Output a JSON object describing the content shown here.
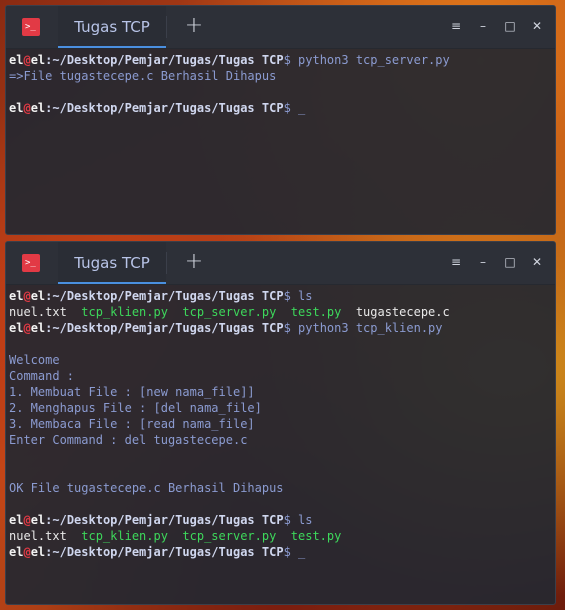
{
  "windows": [
    {
      "tab_title": "Tugas TCP",
      "lines": [
        {
          "type": "prompt",
          "user": "el",
          "at": "@",
          "host": "el",
          "path": ":~/Desktop/Pemjar/Tugas/Tugas TCP",
          "dollar": "$ ",
          "cmd": "python3 tcp_server.py"
        },
        {
          "type": "out",
          "text": "=>File tugastecepe.c Berhasil Dihapus"
        },
        {
          "type": "blank"
        },
        {
          "type": "prompt",
          "user": "el",
          "at": "@",
          "host": "el",
          "path": ":~/Desktop/Pemjar/Tugas/Tugas TCP",
          "dollar": "$ ",
          "cmd": "_"
        }
      ]
    },
    {
      "tab_title": "Tugas TCP",
      "lines": [
        {
          "type": "prompt",
          "user": "el",
          "at": "@",
          "host": "el",
          "path": ":~/Desktop/Pemjar/Tugas/Tugas TCP",
          "dollar": "$ ",
          "cmd": "ls"
        },
        {
          "type": "files",
          "files": [
            {
              "name": "nuel.txt",
              "kind": "file"
            },
            {
              "name": "tcp_klien.py",
              "kind": "exec"
            },
            {
              "name": "tcp_server.py",
              "kind": "exec"
            },
            {
              "name": "test.py",
              "kind": "exec"
            },
            {
              "name": "tugastecepe.c",
              "kind": "file"
            }
          ]
        },
        {
          "type": "prompt",
          "user": "el",
          "at": "@",
          "host": "el",
          "path": ":~/Desktop/Pemjar/Tugas/Tugas TCP",
          "dollar": "$ ",
          "cmd": "python3 tcp_klien.py"
        },
        {
          "type": "blank"
        },
        {
          "type": "out",
          "text": "Welcome"
        },
        {
          "type": "out",
          "text": "Command :"
        },
        {
          "type": "out",
          "text": "1. Membuat File : [new nama_file]]"
        },
        {
          "type": "out",
          "text": "2. Menghapus File : [del nama_file]"
        },
        {
          "type": "out",
          "text": "3. Membaca File : [read nama_file]"
        },
        {
          "type": "out",
          "text": "Enter Command : del tugastecepe.c"
        },
        {
          "type": "blank"
        },
        {
          "type": "blank"
        },
        {
          "type": "out",
          "text": "OK File tugastecepe.c Berhasil Dihapus"
        },
        {
          "type": "blank"
        },
        {
          "type": "prompt",
          "user": "el",
          "at": "@",
          "host": "el",
          "path": ":~/Desktop/Pemjar/Tugas/Tugas TCP",
          "dollar": "$ ",
          "cmd": "ls"
        },
        {
          "type": "files",
          "files": [
            {
              "name": "nuel.txt",
              "kind": "file"
            },
            {
              "name": "tcp_klien.py",
              "kind": "exec"
            },
            {
              "name": "tcp_server.py",
              "kind": "exec"
            },
            {
              "name": "test.py",
              "kind": "exec"
            }
          ]
        },
        {
          "type": "prompt",
          "user": "el",
          "at": "@",
          "host": "el",
          "path": ":~/Desktop/Pemjar/Tugas/Tugas TCP",
          "dollar": "$ ",
          "cmd": "_"
        }
      ]
    }
  ],
  "icons": {
    "terminal": "terminal-icon",
    "new_tab": "plus-icon",
    "menu": "hamburger-icon",
    "minimize": "minimize-icon",
    "maximize": "maximize-icon",
    "close": "close-icon"
  },
  "glyphs": {
    "terminal": ">_",
    "new_tab": "+",
    "menu": "≡",
    "minimize": "–",
    "maximize": "□",
    "close": "✕"
  },
  "colors": {
    "prompt_at": "#e23a45",
    "executable": "#3dd85b",
    "output": "#8b9bd1",
    "tab_underline": "#4a8fe0"
  }
}
